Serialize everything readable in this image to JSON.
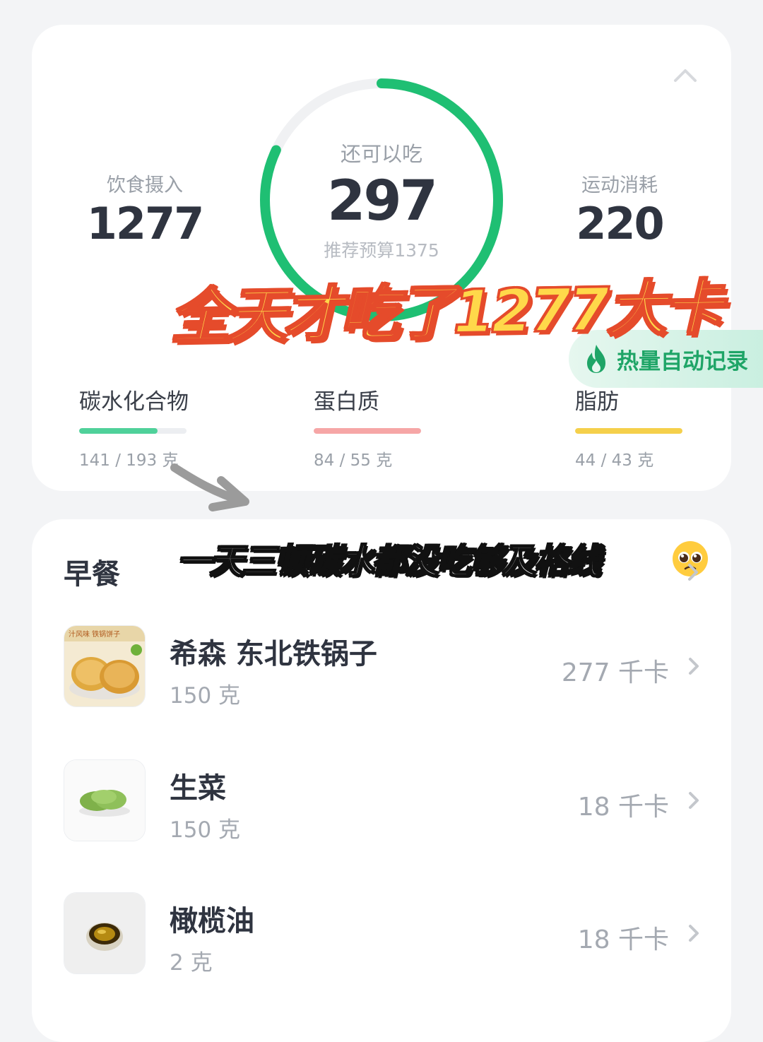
{
  "summary": {
    "intake": {
      "label": "饮食摄入",
      "value": "1277"
    },
    "remaining": {
      "label": "还可以吃",
      "value": "297",
      "budget": "推荐预算1375",
      "ring_fraction": 0.82
    },
    "exercise": {
      "label": "运动消耗",
      "value": "220"
    },
    "caption": "全天才吃了1277大卡",
    "auto_record": "热量自动记录",
    "macros": [
      {
        "label": "碳水化合物",
        "value": "141 / 193 克",
        "fill": 0.73,
        "color": "#4fd19a"
      },
      {
        "label": "蛋白质",
        "value": "84 / 55 克",
        "fill": 1.0,
        "color": "#f6a6a6"
      },
      {
        "label": "脂肪",
        "value": "44 / 43 克",
        "fill": 1.0,
        "color": "#f5d04b"
      }
    ]
  },
  "meal": {
    "title": "早餐",
    "caption": "一天三顿碳水都没吃够及格线",
    "items": [
      {
        "name": "希森 东北铁锅子",
        "amount": "150 克",
        "kcal": "277 千卡",
        "thumb_label": "汁风味 铁锅饼子"
      },
      {
        "name": "生菜",
        "amount": "150 克",
        "kcal": "18 千卡"
      },
      {
        "name": "橄榄油",
        "amount": "2 克",
        "kcal": "18 千卡"
      }
    ]
  },
  "colors": {
    "ring": "#1fbf73",
    "ring_track": "#f0f1f3",
    "accent_green": "#1fa567"
  },
  "icons": [
    "chevron-up-icon",
    "flame-icon",
    "arrow-icon",
    "pleading-face-emoji",
    "chevron-right-icon"
  ]
}
